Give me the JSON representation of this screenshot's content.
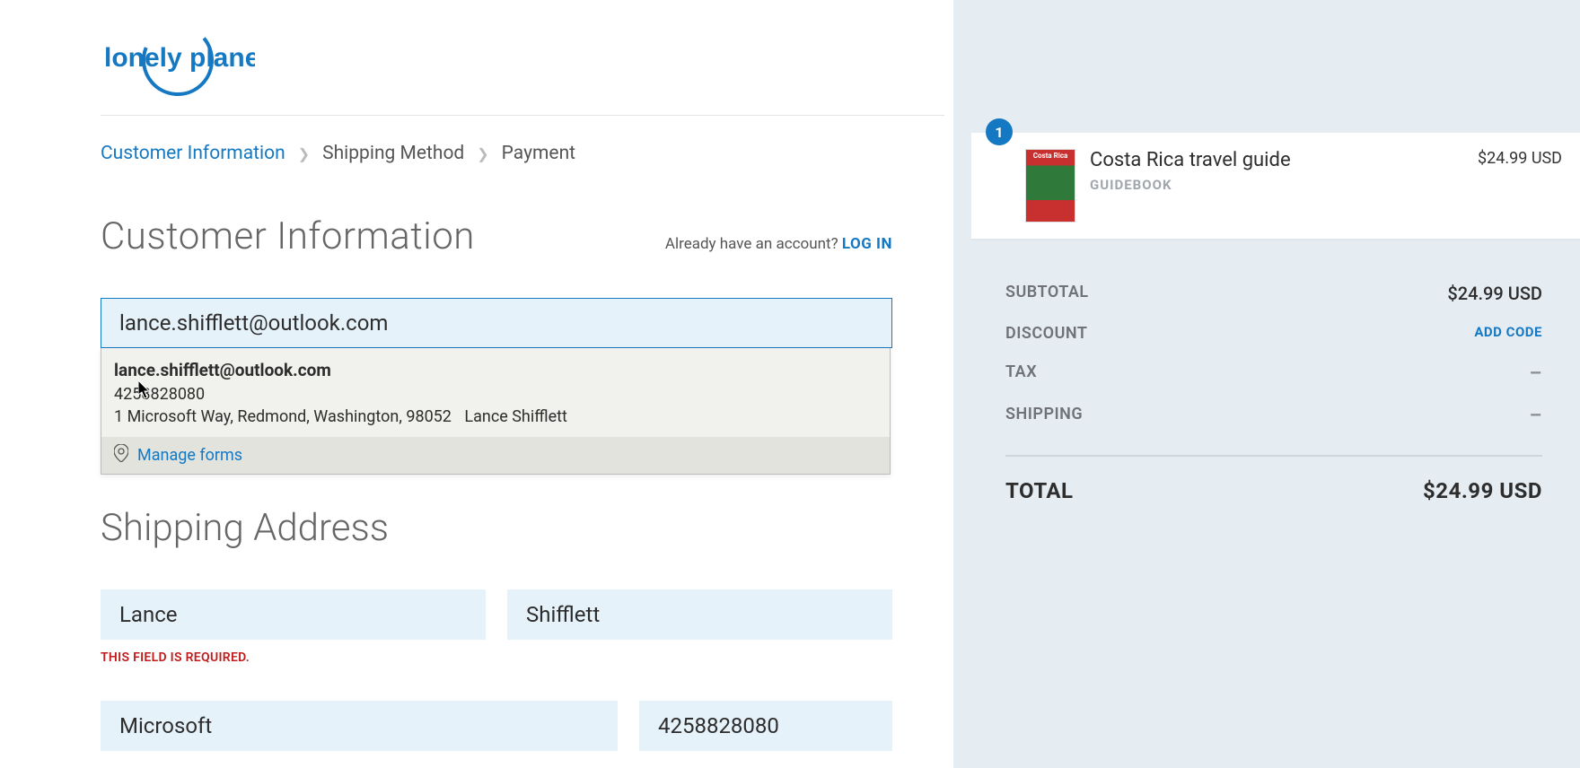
{
  "brand": {
    "name": "lonely planet"
  },
  "breadcrumbs": {
    "step1": "Customer Information",
    "step2": "Shipping Method",
    "step3": "Payment"
  },
  "customer_info": {
    "heading": "Customer Information",
    "account_question": "Already have an account? ",
    "login_label": "LOG IN",
    "email_value": "lance.shifflett@outlook.com"
  },
  "autofill": {
    "email": "lance.shifflett@outlook.com",
    "phone": "4258828080",
    "address": "1 Microsoft Way, Redmond, Washington, 98052",
    "name": "Lance Shifflett",
    "manage_label": "Manage forms"
  },
  "shipping": {
    "heading": "Shipping Address",
    "first_name": "Lance",
    "last_name": "Shifflett",
    "error_required": "THIS FIELD IS REQUIRED.",
    "company": "Microsoft",
    "phone": "4258828080"
  },
  "cart": {
    "quantity": "1",
    "item_title": "Costa Rica travel guide",
    "item_type": "GUIDEBOOK",
    "item_price": "$24.99 USD",
    "thumb_text": "Costa Rica"
  },
  "totals": {
    "subtotal_label": "SUBTOTAL",
    "subtotal_value": "$24.99 USD",
    "discount_label": "DISCOUNT",
    "discount_action": "ADD CODE",
    "tax_label": "TAX",
    "tax_value": "–",
    "shipping_label": "SHIPPING",
    "shipping_value": "–",
    "total_label": "TOTAL",
    "total_value": "$24.99 USD"
  }
}
